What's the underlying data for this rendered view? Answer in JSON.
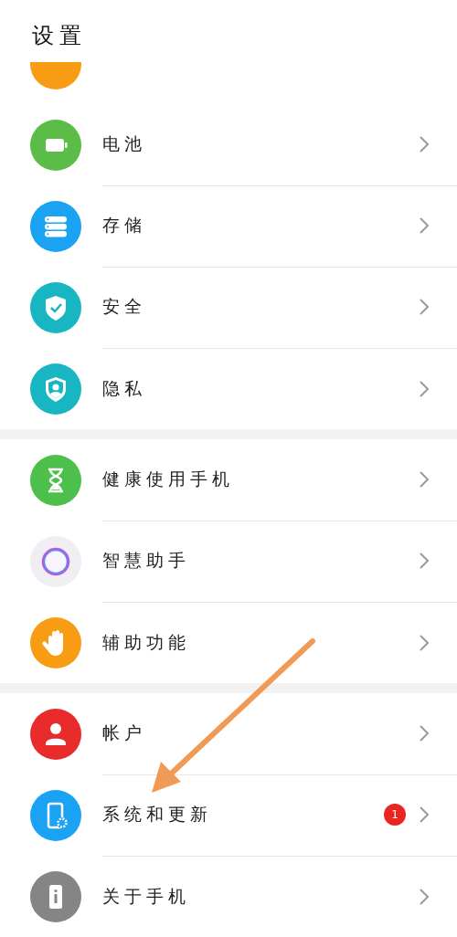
{
  "title": "设置",
  "groups": [
    {
      "items": [
        {
          "label": "电池"
        },
        {
          "label": "存储"
        },
        {
          "label": "安全"
        },
        {
          "label": "隐私"
        }
      ]
    },
    {
      "items": [
        {
          "label": "健康使用手机"
        },
        {
          "label": "智慧助手"
        },
        {
          "label": "辅助功能"
        }
      ]
    },
    {
      "items": [
        {
          "label": "帐户"
        },
        {
          "label": "系统和更新",
          "badge": "1"
        },
        {
          "label": "关于手机"
        }
      ]
    }
  ]
}
